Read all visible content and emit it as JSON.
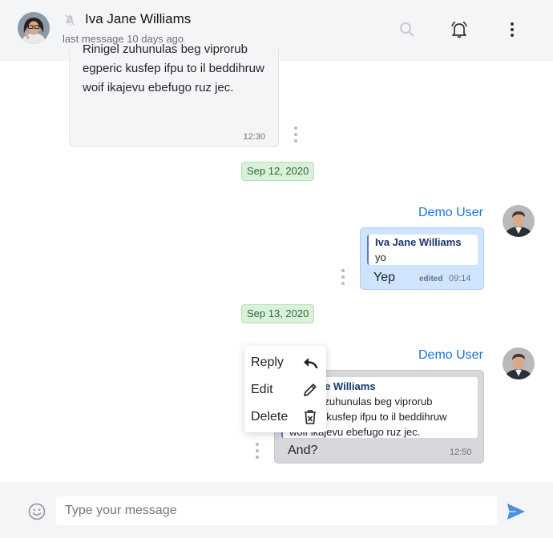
{
  "header": {
    "contact_name": "Iva Jane Williams",
    "last_seen": "last message 10 days ago",
    "icons": [
      "avatar",
      "bell-muted-icon",
      "search-icon",
      "bell-alarm-icon",
      "more-vertical-icon"
    ]
  },
  "messages": [
    {
      "type": "incoming",
      "text": "Rinigel zuhunulas beg viprorub egperic kusfep ifpu to il beddihruw woif ikajevu ebefugo ruz jec.",
      "time": "12:30"
    },
    {
      "type": "date",
      "label": "Sep 12, 2020"
    },
    {
      "type": "outgoing",
      "sender": "Demo User",
      "quote_name": "Iva Jane Williams",
      "quote_text": "yo",
      "text": "Yep",
      "edited": "edited",
      "time": "09:14"
    },
    {
      "type": "date",
      "label": "Sep 13, 2020"
    },
    {
      "type": "outgoing-selected",
      "sender": "Demo User",
      "quote_name": "Iva Jane Williams",
      "quote_lines": [
        "Rinigel zuhunulas beg viprorub",
        "egperic kusfep ifpu to il beddihruw",
        "woif ikajevu ebefugo ruz jec."
      ],
      "text": "And?",
      "time": "12:50"
    }
  ],
  "context_menu": {
    "items": [
      {
        "label": "Reply",
        "icon": "reply-icon"
      },
      {
        "label": "Edit",
        "icon": "pencil-icon"
      },
      {
        "label": "Delete",
        "icon": "trash-icon"
      }
    ]
  },
  "composer": {
    "placeholder": "Type your message",
    "value": "",
    "icons": [
      "emoji-icon",
      "send-icon"
    ]
  },
  "colors": {
    "header_bg": "#f4f5f7",
    "outgoing_bubble": "#cfe5ff",
    "selected_bubble": "#d6d8db",
    "date_chip": "#d9f1d9",
    "sender_name": "#1a73d8",
    "send_icon": "#4a8fe0"
  }
}
